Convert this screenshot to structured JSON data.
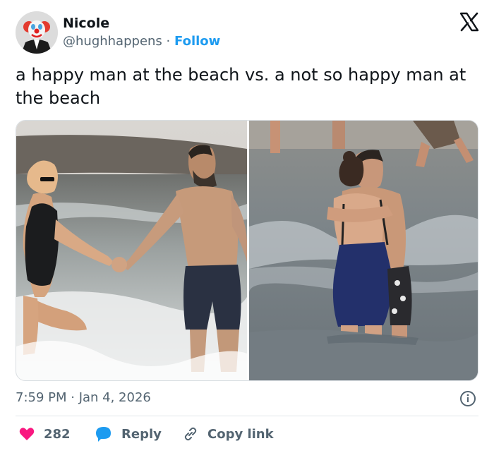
{
  "user": {
    "display_name": "Nicole",
    "handle": "@hughhappens",
    "separator": "·",
    "follow_label": "Follow",
    "avatar_icon": "clown-avatar"
  },
  "brand": {
    "logo_icon": "x-logo-icon"
  },
  "tweet": {
    "text": "a happy man at the beach vs. a not so happy man at the beach",
    "timestamp": "7:59 PM · Jan 4, 2026"
  },
  "media": {
    "left_photo": "couple-walking-in-surf",
    "right_photo": "couple-embracing-in-sea"
  },
  "actions": {
    "likes_count": "282",
    "reply_label": "Reply",
    "copy_link_label": "Copy link"
  },
  "colors": {
    "accent": "#1d9bf0",
    "like": "#f91880",
    "text": "#0f1419",
    "muted": "#536471"
  }
}
